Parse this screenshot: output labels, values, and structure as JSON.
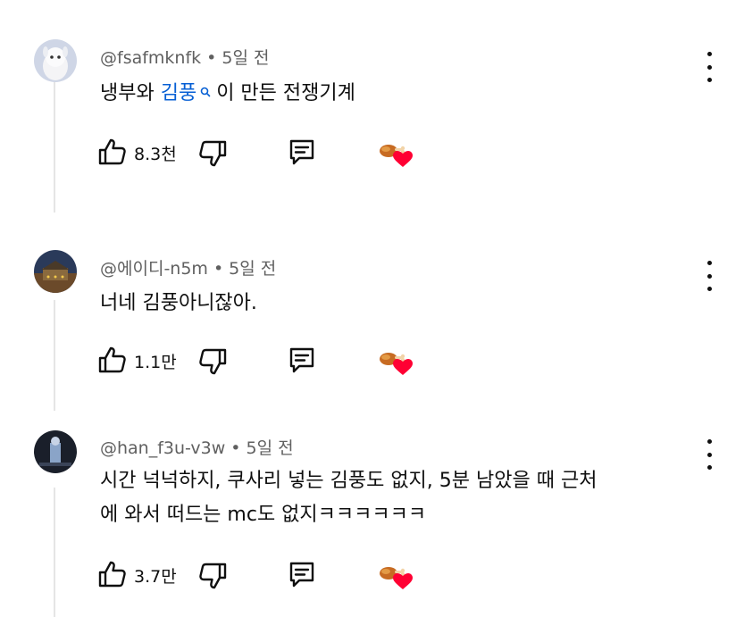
{
  "comments": [
    {
      "handle": "@fsafmknfk",
      "time": "5일 전",
      "text_before": "냉부와 ",
      "text_link": "김풍",
      "text_after": "이 만든 전쟁기계",
      "likes": "8.3천",
      "icons": {
        "like": "thumbs-up-icon",
        "dislike": "thumbs-down-icon",
        "reply": "reply-icon",
        "heart": "creator-heart-icon",
        "more": "more-vertical-icon",
        "search": "search-icon"
      }
    },
    {
      "handle": "@에이디-n5m",
      "time": "5일 전",
      "text": "너네 김풍아니잖아.",
      "likes": "1.1만"
    },
    {
      "handle": "@han_f3u-v3w",
      "time": "5일 전",
      "text_line1": "시간 넉넉하지, 쿠사리 넣는 김풍도 없지, 5분 남았을 때 근처",
      "text_line2": "에 와서 떠드는 mc도 없지ㅋㅋㅋㅋㅋㅋ",
      "likes": "3.7만"
    }
  ],
  "separator": "•",
  "colors": {
    "text": "#0f0f0f",
    "meta": "#606060",
    "link": "#065fd4",
    "heart": "#ff0033"
  }
}
